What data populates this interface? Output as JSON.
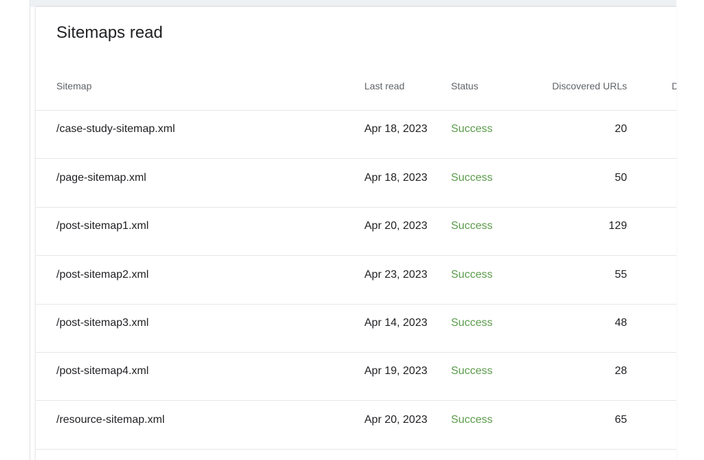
{
  "card": {
    "title": "Sitemaps read"
  },
  "table": {
    "headers": {
      "sitemap": "Sitemap",
      "last_read": "Last read",
      "status": "Status",
      "discovered_urls": "Discovered URLs",
      "cut_off": "D"
    },
    "rows": [
      {
        "sitemap": "/case-study-sitemap.xml",
        "last_read": "Apr 18, 2023",
        "status": "Success",
        "discovered_urls": "20"
      },
      {
        "sitemap": "/page-sitemap.xml",
        "last_read": "Apr 18, 2023",
        "status": "Success",
        "discovered_urls": "50"
      },
      {
        "sitemap": "/post-sitemap1.xml",
        "last_read": "Apr 20, 2023",
        "status": "Success",
        "discovered_urls": "129"
      },
      {
        "sitemap": "/post-sitemap2.xml",
        "last_read": "Apr 23, 2023",
        "status": "Success",
        "discovered_urls": "55"
      },
      {
        "sitemap": "/post-sitemap3.xml",
        "last_read": "Apr 14, 2023",
        "status": "Success",
        "discovered_urls": "48"
      },
      {
        "sitemap": "/post-sitemap4.xml",
        "last_read": "Apr 19, 2023",
        "status": "Success",
        "discovered_urls": "28"
      },
      {
        "sitemap": "/resource-sitemap.xml",
        "last_read": "Apr 20, 2023",
        "status": "Success",
        "discovered_urls": "65"
      }
    ]
  },
  "colors": {
    "status_success": "#5a9b4a",
    "text_primary": "#202124",
    "text_secondary": "#5f6368",
    "divider": "#e6e6e6"
  }
}
